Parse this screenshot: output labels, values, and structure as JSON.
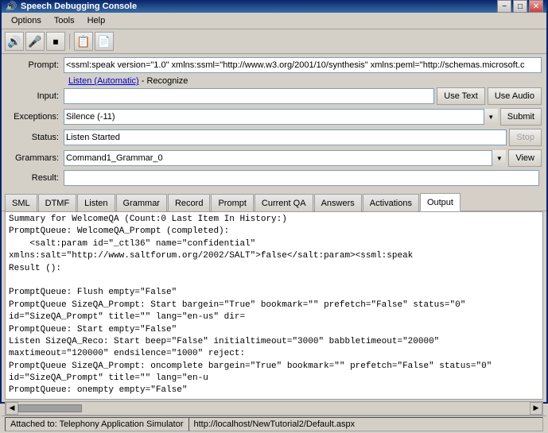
{
  "titlebar": {
    "title": "Speech Debugging Console",
    "icon": "🔊",
    "minimize": "−",
    "maximize": "□",
    "close": "✕"
  },
  "menubar": {
    "items": [
      "Options",
      "Tools",
      "Help"
    ]
  },
  "toolbar": {
    "buttons": [
      "⬅",
      "➡",
      "🔊",
      "|",
      "📋",
      "📄"
    ]
  },
  "form": {
    "prompt_label": "Prompt:",
    "prompt_value": "<ssml:speak version=\"1.0\" xmlns:ssml=\"http://www.w3.org/2001/10/synthesis\" xmlns:peml=\"http://schemas.microsoft.c",
    "listen_text": "Listen (Automatic)",
    "recognize_text": "- Recognize",
    "input_label": "Input:",
    "input_value": "",
    "use_text_btn": "Use Text",
    "use_audio_btn": "Use Audio",
    "exceptions_label": "Exceptions:",
    "exceptions_value": "Silence (-11)",
    "submit_btn": "Submit",
    "status_label": "Status:",
    "status_value": "Listen Started",
    "stop_btn": "Stop",
    "grammars_label": "Grammars:",
    "grammars_value": "Command1_Grammar_0",
    "view_btn": "View",
    "result_label": "Result:",
    "result_value": ""
  },
  "tabs": {
    "items": [
      "SML",
      "DTMF",
      "Listen",
      "Grammar",
      "Record",
      "Prompt",
      "Current QA",
      "Answers",
      "Activations",
      "Output"
    ],
    "active": "Output"
  },
  "output": {
    "content": "Summary for WelcomeQA (Count:0 Last Item In History:)\nPromptQueue: WelcomeQA_Prompt (completed):\n    <salt:param id=\"_ctl36\" name=\"confidential\" xmlns:salt=\"http://www.saltforum.org/2002/SALT\">false</salt:param><ssml:speak\nResult ():\n\nPromptQueue: Flush empty=\"False\"\nPromptQueue SizeQA_Prompt: Start bargein=\"True\" bookmark=\"\" prefetch=\"False\" status=\"0\" id=\"SizeQA_Prompt\" title=\"\" lang=\"en-us\" dir=\nPromptQueue: Start empty=\"False\"\nListen SizeQA_Reco: Start beep=\"False\" initialtimeout=\"3000\" babbletimeout=\"20000\" maxtimeout=\"120000\" endsilence=\"1000\" reject:\nPromptQueue SizeQA_Prompt: oncomplete bargein=\"True\" bookmark=\"\" prefetch=\"False\" status=\"0\" id=\"SizeQA_Prompt\" title=\"\" lang=\"en-u\nPromptQueue: onempty empty=\"False\""
  },
  "statusbar": {
    "left": "Attached to: Telephony Application Simulator",
    "right": "http://localhost/NewTutorial2/Default.aspx"
  }
}
